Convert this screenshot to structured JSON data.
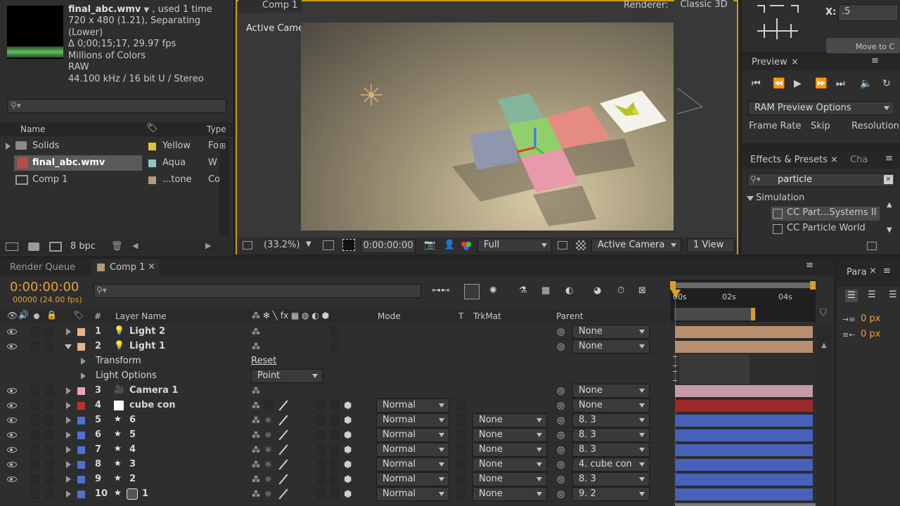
{
  "project": {
    "file_name": "final_abc.wmv",
    "used": ", used 1 time",
    "info": [
      "720 x 480 (1.21), Separating (Lower)",
      "Δ 0;00;15;17, 29.97 fps",
      "Millions of Colors",
      "RAW",
      "44.100 kHz / 16 bit U / Stereo"
    ],
    "col_name": "Name",
    "col_type": "Type",
    "items": [
      {
        "name": "Solids",
        "label": "Yellow",
        "label_color": "#d9c63a",
        "type": "Fo"
      },
      {
        "name": "final_abc.wmv",
        "label": "Aqua",
        "label_color": "#8fc6c2",
        "type": "W"
      },
      {
        "name": "Comp 1",
        "label": "...tone",
        "label_color": "#b29a7c",
        "type": "Co"
      }
    ],
    "bpc": "8 bpc"
  },
  "viewer": {
    "tab": "Comp 1",
    "renderer_label": "Renderer:",
    "renderer_value": "Classic 3D",
    "view_label": "Active Camera",
    "zoom": "(33.2%)",
    "timecode": "0:00:00:00",
    "resolution": "Full",
    "camera": "Active Camera",
    "views": "1 View"
  },
  "info_panel": {
    "x_label": "X:",
    "x_value": ".5",
    "move_btn": "Move to C"
  },
  "preview": {
    "title": "Preview",
    "ram_options": "RAM Preview Options",
    "frame_rate": "Frame Rate",
    "skip": "Skip",
    "resolution": "Resolution"
  },
  "effects": {
    "title": "Effects & Presets",
    "tab2": "Cha",
    "search": "particle",
    "category": "Simulation",
    "items": [
      "CC Part...Systems II",
      "CC Particle World"
    ]
  },
  "paragraph": {
    "title": "Para",
    "indent1": "0 px",
    "indent2": "0 px"
  },
  "timeline": {
    "tab_render": "Render Queue",
    "tab_comp": "Comp 1",
    "timecode": "0:00:00:00",
    "frames": "00000 (24.00 fps)",
    "ruler": [
      "00s",
      "02s",
      "04s"
    ],
    "headers": {
      "num": "#",
      "layer_name": "Layer Name",
      "mode": "Mode",
      "t": "T",
      "trkmat": "TrkMat",
      "parent": "Parent"
    },
    "rows": [
      {
        "num": "1",
        "name": "Light 2",
        "color": "#e6b48c",
        "type": "light",
        "mode": "",
        "trkmat": "",
        "parent": "None",
        "bar": "#b8906f",
        "expanded": false
      },
      {
        "num": "2",
        "name": "Light 1",
        "color": "#e6b48c",
        "type": "light",
        "mode": "",
        "trkmat": "",
        "parent": "None",
        "bar": "#b8906f",
        "expanded": true
      },
      {
        "num": "3",
        "name": "Camera 1",
        "color": "#e8a6b8",
        "type": "camera",
        "mode": "",
        "trkmat": "",
        "parent": "None",
        "bar": "#c69aa6",
        "expanded": false
      },
      {
        "num": "4",
        "name": "cube con",
        "color": "#c03030",
        "type": "solid",
        "mode": "Normal",
        "trkmat": "",
        "parent": "None",
        "bar": "#9b2a2a",
        "expanded": false
      },
      {
        "num": "5",
        "name": "6",
        "color": "#4f6fd1",
        "type": "shape",
        "mode": "Normal",
        "trkmat": "None",
        "parent": "8. 3",
        "bar": "#4760b8",
        "expanded": false
      },
      {
        "num": "6",
        "name": "5",
        "color": "#4f6fd1",
        "type": "shape",
        "mode": "Normal",
        "trkmat": "None",
        "parent": "8. 3",
        "bar": "#4760b8",
        "expanded": false
      },
      {
        "num": "7",
        "name": "4",
        "color": "#4f6fd1",
        "type": "shape",
        "mode": "Normal",
        "trkmat": "None",
        "parent": "8. 3",
        "bar": "#4760b8",
        "expanded": false
      },
      {
        "num": "8",
        "name": "3",
        "color": "#4f6fd1",
        "type": "shape",
        "mode": "Normal",
        "trkmat": "None",
        "parent": "4. cube con",
        "bar": "#4760b8",
        "expanded": false
      },
      {
        "num": "9",
        "name": "2",
        "color": "#4f6fd1",
        "type": "shape",
        "mode": "Normal",
        "trkmat": "None",
        "parent": "8. 3",
        "bar": "#4760b8",
        "expanded": false
      },
      {
        "num": "10",
        "name": "1",
        "color": "#4f6fd1",
        "type": "shape-mask",
        "mode": "Normal",
        "trkmat": "None",
        "parent": "9. 2",
        "bar": "#4760b8",
        "expanded": false
      }
    ],
    "sub_rows": {
      "transform": "Transform",
      "transform_value": "Reset",
      "light_options": "Light Options",
      "light_type": "Point"
    }
  }
}
